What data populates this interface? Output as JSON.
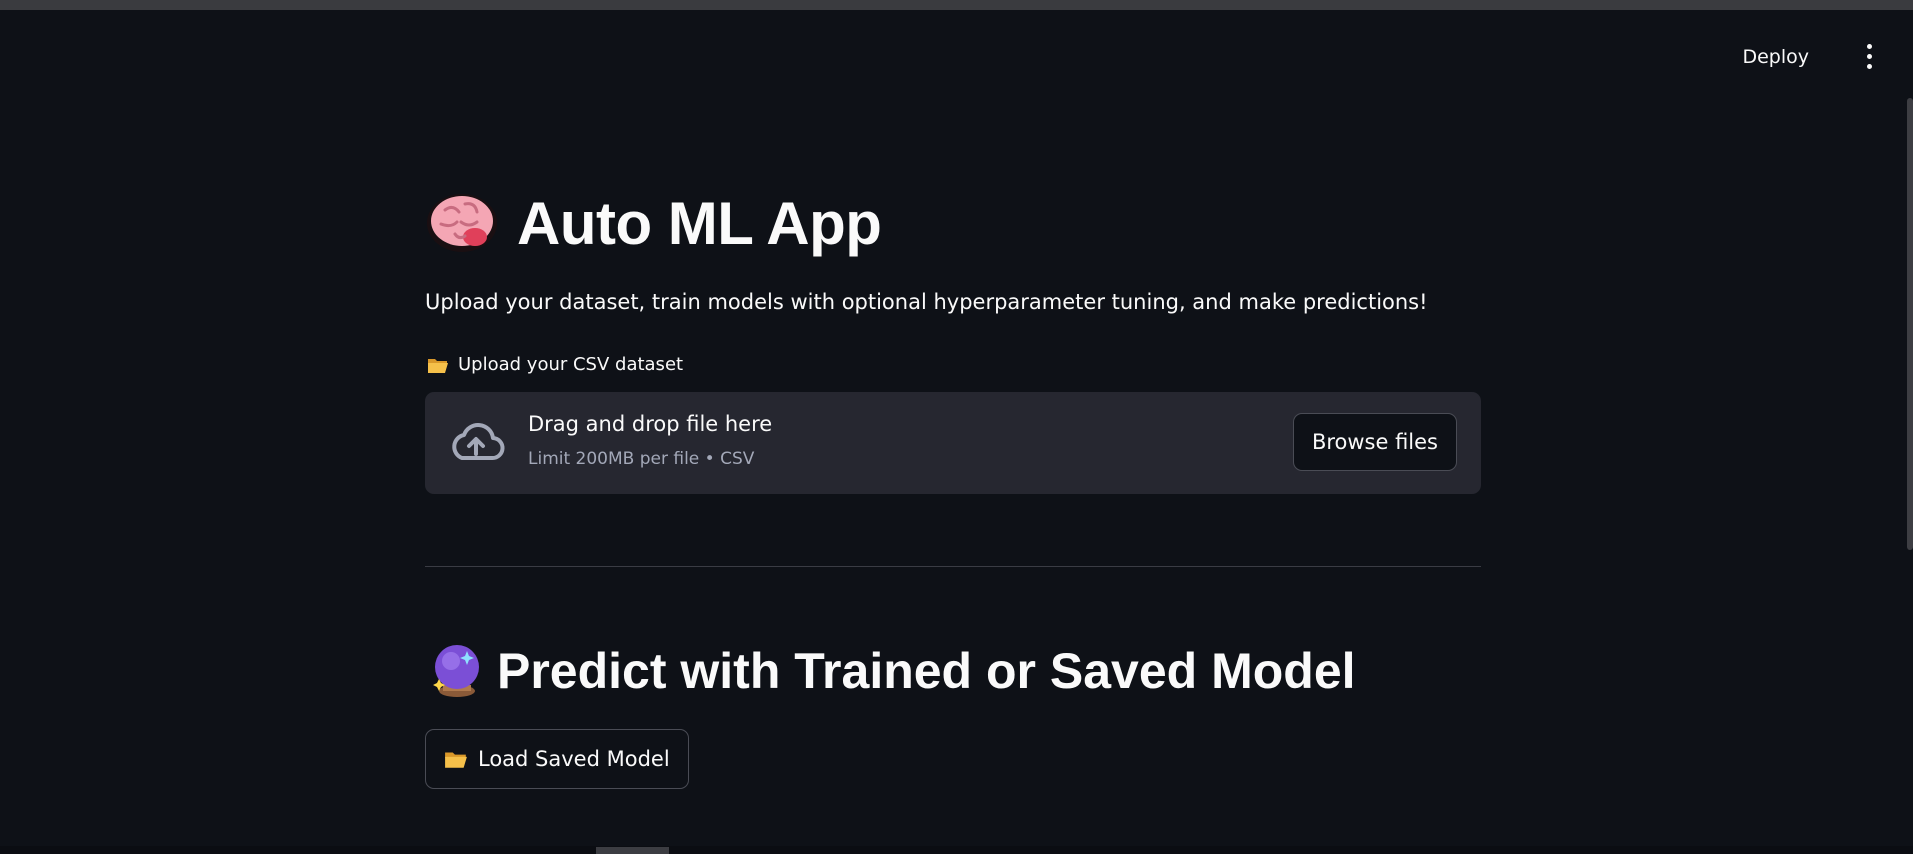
{
  "header": {
    "deploy_label": "Deploy",
    "menu_icon": "vertical-dots-icon"
  },
  "main": {
    "title": "Auto ML App",
    "title_icon": "brain-icon",
    "subtitle": "Upload your dataset, train models with optional hyperparameter tuning, and make predictions!",
    "uploader": {
      "label": "Upload your CSV dataset",
      "label_icon": "open-folder-icon",
      "drop_text": "Drag and drop file here",
      "limit_text": "Limit 200MB per file • CSV",
      "drop_icon": "cloud-upload-icon",
      "browse_label": "Browse files"
    },
    "predict_section": {
      "title": "Predict with Trained or Saved Model",
      "title_icon": "crystal-ball-icon",
      "load_button_label": "Load Saved Model",
      "load_button_icon": "open-folder-icon"
    }
  },
  "colors": {
    "background": "#0e1117",
    "dropzone": "#262730",
    "text": "#fafafa",
    "muted_text": "#a3a8b8",
    "border": "#4a4c55"
  }
}
